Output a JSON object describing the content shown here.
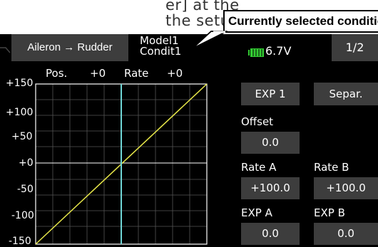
{
  "doc_text": {
    "line1": "er] at the",
    "line2": "the setup"
  },
  "callout": {
    "text": "Currently selected condition"
  },
  "header": {
    "function_tab": "Aileron → Rudder",
    "model": "Model1",
    "condition": "Condit1",
    "voltage": "6.7V",
    "page": "1/2"
  },
  "graph": {
    "y_ticks": [
      "+150",
      "+100",
      "+50",
      "+0",
      "-50",
      "-100",
      "-150"
    ],
    "pos_label": "Pos.",
    "pos_value": "+0",
    "rate_label": "Rate",
    "rate_value": "+0"
  },
  "controls": {
    "exp_button": "EXP 1",
    "separ_button": "Separ.",
    "offset_label": "Offset",
    "offset_value": "0.0",
    "rate_a_label": "Rate A",
    "rate_a_value": "+100.0",
    "rate_b_label": "Rate B",
    "rate_b_value": "+100.0",
    "exp_a_label": "EXP A",
    "exp_a_value": "0.0",
    "exp_b_label": "EXP B",
    "exp_b_value": "0.0"
  },
  "colors": {
    "screen_bg": "#000000",
    "button_bg": "#3d3d3d",
    "curve": "#e8e84a",
    "cursor_line": "#6fd6d6",
    "battery": "#33cc33"
  }
}
